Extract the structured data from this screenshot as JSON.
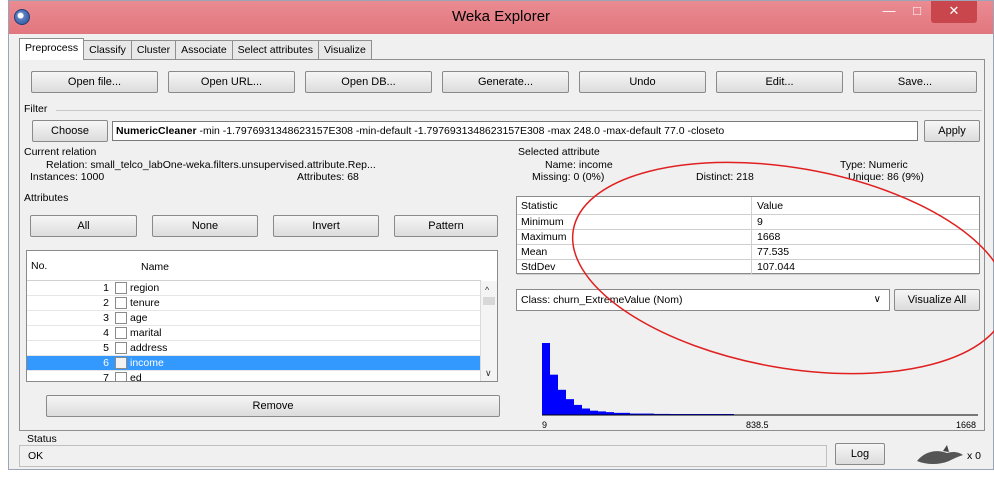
{
  "window": {
    "title": "Weka Explorer"
  },
  "tabs": [
    "Preprocess",
    "Classify",
    "Cluster",
    "Associate",
    "Select attributes",
    "Visualize"
  ],
  "toolbar": {
    "open_file": "Open file...",
    "open_url": "Open URL...",
    "open_db": "Open DB...",
    "generate": "Generate...",
    "undo": "Undo",
    "edit": "Edit...",
    "save": "Save..."
  },
  "filter": {
    "section_label": "Filter",
    "choose_label": "Choose",
    "name": "NumericCleaner",
    "args": " -min -1.7976931348623157E308 -min-default -1.7976931348623157E308 -max 248.0 -max-default 77.0 -closeto",
    "apply_label": "Apply"
  },
  "current_relation": {
    "section_label": "Current relation",
    "relation_label": "Relation:",
    "relation_value": "small_telco_labOne-weka.filters.unsupervised.attribute.Rep...",
    "instances_label": "Instances:",
    "instances_value": "1000",
    "attributes_label": "Attributes:",
    "attributes_value": "68"
  },
  "attributes": {
    "section_label": "Attributes",
    "buttons": {
      "all": "All",
      "none": "None",
      "invert": "Invert",
      "pattern": "Pattern"
    },
    "col_no": "No.",
    "col_name": "Name",
    "rows": [
      {
        "no": "1",
        "name": "region"
      },
      {
        "no": "2",
        "name": "tenure"
      },
      {
        "no": "3",
        "name": "age"
      },
      {
        "no": "4",
        "name": "marital"
      },
      {
        "no": "5",
        "name": "address"
      },
      {
        "no": "6",
        "name": "income"
      },
      {
        "no": "7",
        "name": "ed"
      }
    ],
    "selected_index": 5,
    "remove_label": "Remove"
  },
  "selected_attribute": {
    "section_label": "Selected attribute",
    "name_label": "Name:",
    "name_value": "income",
    "type_label": "Type:",
    "type_value": "Numeric",
    "missing_label": "Missing:",
    "missing_value": "0 (0%)",
    "distinct_label": "Distinct:",
    "distinct_value": "218",
    "unique_label": "Unique:",
    "unique_value": "86 (9%)",
    "stats_header": {
      "statistic": "Statistic",
      "value": "Value"
    },
    "stats": [
      {
        "statistic": "Minimum",
        "value": "9"
      },
      {
        "statistic": "Maximum",
        "value": "1668"
      },
      {
        "statistic": "Mean",
        "value": "77.535"
      },
      {
        "statistic": "StdDev",
        "value": "107.044"
      }
    ]
  },
  "class_selector": {
    "value": "Class: churn_ExtremeValue (Nom)",
    "visualize_all_label": "Visualize All"
  },
  "histogram": {
    "min_label": "9",
    "mid_label": "838.5",
    "max_label": "1668",
    "bar_color": "#0000ff",
    "bars": [
      1.0,
      0.56,
      0.35,
      0.22,
      0.14,
      0.09,
      0.06,
      0.05,
      0.04,
      0.03,
      0.03,
      0.02,
      0.02,
      0.02,
      0.015,
      0.015,
      0.01,
      0.01,
      0.01,
      0.01,
      0.008,
      0.008,
      0.006,
      0.006
    ]
  },
  "status": {
    "section_label": "Status",
    "message": "OK",
    "log_label": "Log",
    "count": "x 0"
  },
  "colors": {
    "titlebar": "#e2767e",
    "close_button": "#c8464c",
    "selection": "#3399ff",
    "annotation": "#e02020"
  }
}
